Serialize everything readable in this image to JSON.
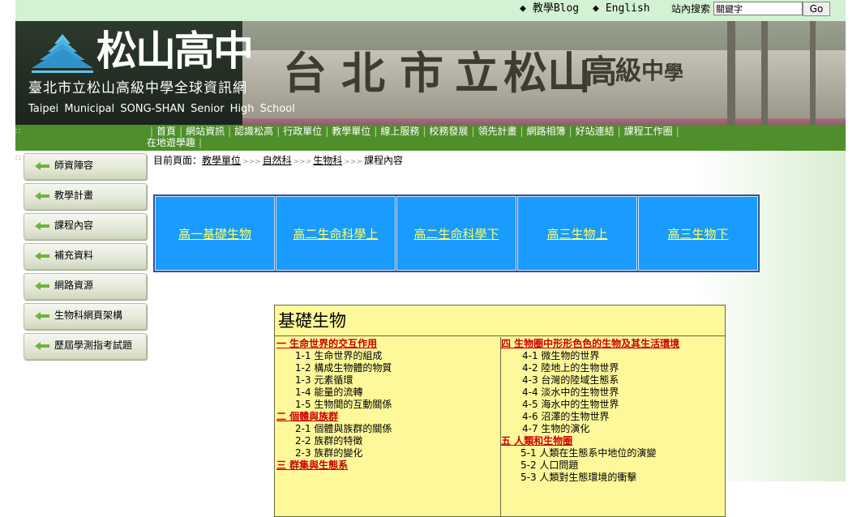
{
  "topbar": {
    "links": [
      "教學Blog",
      "English"
    ],
    "search_label": "站內搜索",
    "search_value": "關鍵字",
    "go_label": "Go"
  },
  "banner": {
    "logo_text": "松山高中",
    "full_name": "臺北市立松山高級中學全球資訊網",
    "english_name": "Taipei  Municipal  SONG-SHAN  Senior  High  School",
    "photo_text": [
      "台",
      "北",
      "市",
      "立",
      "松",
      "山",
      "高",
      "級",
      "中",
      "學"
    ]
  },
  "nav": {
    "items": [
      "首頁",
      "網站資訊",
      "認識松高",
      "行政單位",
      "教學單位",
      "線上服務",
      "校務發展",
      "領先計畫",
      "網路相簿",
      "好站連結",
      "課程工作圈",
      "在地遊學趣"
    ]
  },
  "sidebar": {
    "items": [
      "師資陣容",
      "教學計畫",
      "課程內容",
      "補充資料",
      "網路資源",
      "生物科網頁架構",
      "歷屆學測指考試題"
    ]
  },
  "breadcrumb": {
    "prefix": "目前頁面：",
    "links": [
      "教學單位",
      "自然科",
      "生物科"
    ],
    "current": "課程內容",
    "separator": ">>>"
  },
  "tabs": [
    "高一基礎生物",
    "高二生命科學上",
    "高二生命科學下",
    "高三生物上",
    "高三生物下"
  ],
  "content": {
    "title": "基礎生物",
    "left": [
      {
        "chapter": "一 生命世界的交互作用",
        "items": [
          "1-1 生命世界的組成",
          "1-2 構成生物體的物質",
          "1-3 元素循環",
          "1-4 能量的流轉",
          "1-5 生物間的互動關係"
        ]
      },
      {
        "chapter": "二 個體與族群",
        "items": [
          "2-1 個體與族群的關係",
          "2-2 族群的特徵",
          "2-3 族群的變化"
        ]
      },
      {
        "chapter": "三 群集與生態系",
        "items": []
      }
    ],
    "right": [
      {
        "chapter": "四 生物圈中形形色色的生物及其生活環境",
        "items": [
          "4-1 微生物的世界",
          "4-2 陸地上的生物世界",
          "4-3 台灣的陸域生態系",
          "4-4 淡水中的生物世界",
          "4-5 海水中的生物世界",
          "4-6 沼澤的生物世界",
          "4-7 生物的演化"
        ]
      },
      {
        "chapter": "五 人類和生物圈",
        "items": [
          "5-1 人類在生態系中地位的演變",
          "5-2 人口問題",
          "5-3 人類對生態環境的衝擊"
        ]
      }
    ]
  },
  "colors": {
    "topbar_bg": "#d3f1d3",
    "nav_bg": "#4e8f2b",
    "tab_bg": "#1a9bff",
    "tab_text": "#ffff66",
    "content_bg": "#fdf89a",
    "chapter_text": "#cc0000"
  }
}
